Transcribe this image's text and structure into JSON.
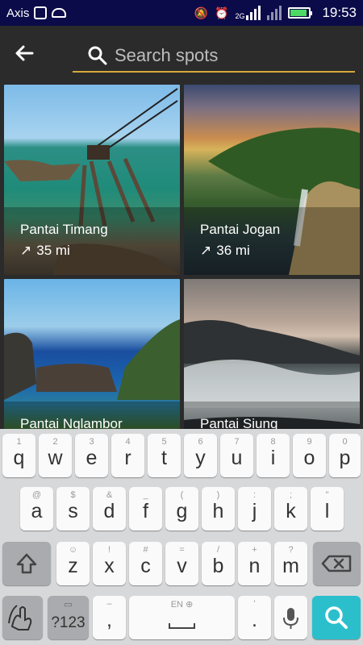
{
  "status_bar": {
    "carrier": "Axis",
    "network_label": "2G",
    "time": "19:53"
  },
  "toolbar": {
    "back_icon": "arrow-left-icon",
    "search": {
      "placeholder": "Search spots",
      "value": ""
    }
  },
  "spots": [
    {
      "name": "Pantai Timang",
      "distance": "35 mi"
    },
    {
      "name": "Pantai Jogan",
      "distance": "36 mi"
    },
    {
      "name": "Pantai Nglambor",
      "distance": ""
    },
    {
      "name": "Pantai Siung",
      "distance": ""
    }
  ],
  "keyboard": {
    "row1": [
      {
        "label": "q",
        "hint": "1"
      },
      {
        "label": "w",
        "hint": "2"
      },
      {
        "label": "e",
        "hint": "3"
      },
      {
        "label": "r",
        "hint": "4"
      },
      {
        "label": "t",
        "hint": "5"
      },
      {
        "label": "y",
        "hint": "6"
      },
      {
        "label": "u",
        "hint": "7"
      },
      {
        "label": "i",
        "hint": "8"
      },
      {
        "label": "o",
        "hint": "9"
      },
      {
        "label": "p",
        "hint": "0"
      }
    ],
    "row2": [
      {
        "label": "a",
        "hint": "@"
      },
      {
        "label": "s",
        "hint": "$"
      },
      {
        "label": "d",
        "hint": "&"
      },
      {
        "label": "f",
        "hint": "_"
      },
      {
        "label": "g",
        "hint": "("
      },
      {
        "label": "h",
        "hint": ")"
      },
      {
        "label": "j",
        "hint": ":"
      },
      {
        "label": "k",
        "hint": ";"
      },
      {
        "label": "l",
        "hint": "\""
      }
    ],
    "row3": [
      {
        "label": "z",
        "hint": "☺"
      },
      {
        "label": "x",
        "hint": "!"
      },
      {
        "label": "c",
        "hint": "#"
      },
      {
        "label": "v",
        "hint": "="
      },
      {
        "label": "b",
        "hint": "/"
      },
      {
        "label": "n",
        "hint": "+"
      },
      {
        "label": "m",
        "hint": "?"
      }
    ],
    "row4": {
      "numbers_label": "?123",
      "comma_label": ",",
      "space_hint": "EN",
      "period_label": ".",
      "period_hint": "'"
    }
  },
  "colors": {
    "status_bar": "#0b0b4a",
    "search_underline": "#d6a93a",
    "search_key": "#2bbfcc"
  }
}
